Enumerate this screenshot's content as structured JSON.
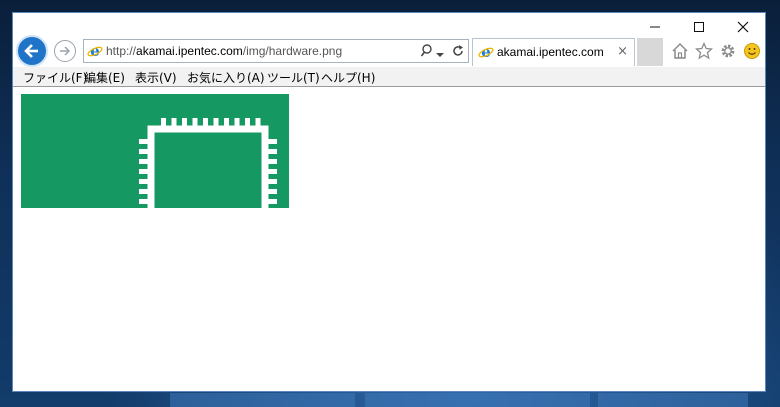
{
  "window": {
    "minimize_icon": "minimize-icon",
    "maximize_icon": "maximize-icon",
    "close_icon": "close-icon"
  },
  "nav": {
    "back_icon": "back-arrow-icon",
    "forward_icon": "forward-arrow-icon"
  },
  "address_bar": {
    "url_prefix": "http://",
    "url_host": "akamai.ipentec.com",
    "url_path": "/img/hardware.png",
    "site_icon": "ie-logo-icon",
    "search_icon": "search-icon",
    "dropdown_icon": "chevron-down-icon",
    "refresh_icon": "refresh-icon"
  },
  "tab": {
    "title": "akamai.ipentec.com",
    "close_label": "×"
  },
  "toolbar": {
    "home_icon": "home-icon",
    "favorites_icon": "star-icon",
    "settings_icon": "gear-icon",
    "feedback_icon": "smiley-icon"
  },
  "menu": {
    "items": [
      "ファイル(F)",
      "編集(E)",
      "表示(V)",
      "お気に入り(A)",
      "ツール(T)",
      "ヘルプ(H)"
    ]
  },
  "content": {
    "image_icon": "chip-icon",
    "image_bg": "#169862"
  }
}
